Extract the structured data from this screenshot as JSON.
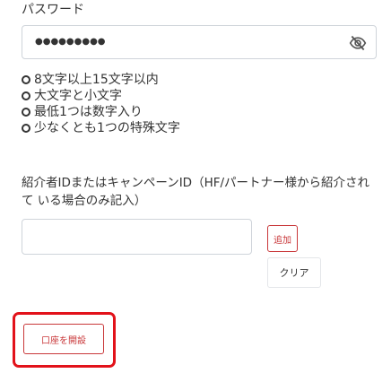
{
  "password": {
    "label": "パスワード",
    "value": "●●●●●●●●●",
    "toggle_icon": "eye-slash-icon"
  },
  "rules": [
    {
      "text": "8文字以上15文字以内"
    },
    {
      "text": "大文字と小文字"
    },
    {
      "text": "最低1つは数字入り"
    },
    {
      "text": "少なくとも1つの特殊文字"
    }
  ],
  "referral": {
    "description": "紹介者IDまたはキャンペーンID（HF/パートナー様から紹介されて いる場合のみ記入）",
    "input_value": "",
    "add_label": "追加",
    "clear_label": "クリア"
  },
  "submit": {
    "label": "口座を開設"
  },
  "colors": {
    "accent": "#c9383a",
    "highlight": "#e2121a"
  }
}
